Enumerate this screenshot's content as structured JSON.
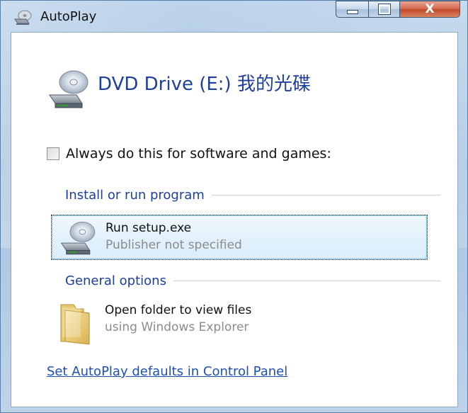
{
  "window": {
    "title": "AutoPlay",
    "controls": {
      "close_glyph": "X"
    }
  },
  "device": {
    "title": "DVD Drive (E:) 我的光碟",
    "icon": "dvd-drive-icon"
  },
  "always_checkbox": {
    "label": "Always do this for software and games:",
    "checked": false
  },
  "sections": [
    {
      "label": "Install or run program",
      "options": [
        {
          "title": "Run setup.exe",
          "subtitle": "Publisher not specified",
          "icon": "dvd-drive-icon",
          "selected": true
        }
      ]
    },
    {
      "label": "General options",
      "options": [
        {
          "title": "Open folder to view files",
          "subtitle": "using Windows Explorer",
          "icon": "folder-icon",
          "selected": false
        }
      ]
    }
  ],
  "footer_link": "Set AutoPlay defaults in Control Panel",
  "colors": {
    "heading_blue": "#1e3f9e",
    "link_blue": "#1d4fb8",
    "selection_bg": "#d8edfa",
    "subtext_gray": "#8b8b8b"
  }
}
